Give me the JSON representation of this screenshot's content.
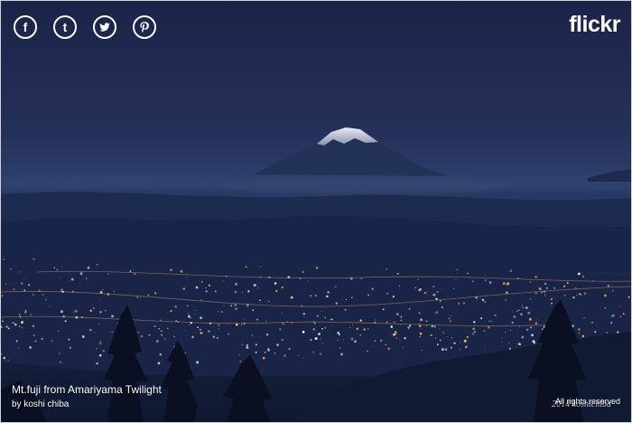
{
  "share": {
    "facebook_glyph": "f",
    "tumblr_glyph": "t",
    "facebook_icon": "facebook-icon",
    "tumblr_icon": "tumblr-icon",
    "twitter_icon": "twitter-icon",
    "pinterest_icon": "pinterest-icon"
  },
  "brand": {
    "label": "flickr"
  },
  "photo": {
    "title": "Mt.fuji from Amariyama Twilight",
    "author": "by koshi chiba",
    "rights": "All rights reserved",
    "watermark": "2014 koshichiba"
  },
  "colors": {
    "sky_top": "#1b2347",
    "sky_mid": "#2a3b68",
    "mountain": "#233257",
    "city_lights": "#f4e6a8",
    "icon_stroke": "#ffffff"
  }
}
